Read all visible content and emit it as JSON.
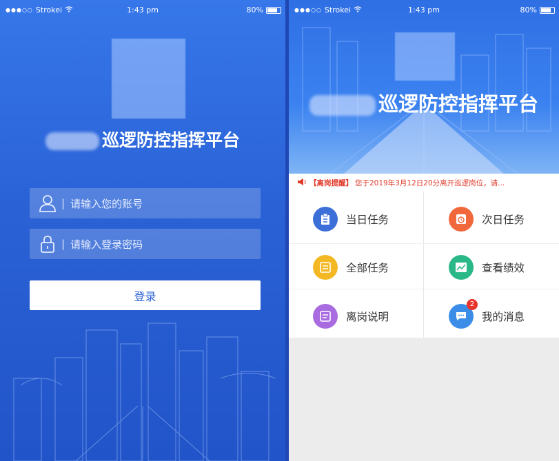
{
  "login": {
    "status": {
      "carrier": "Strokei",
      "time": "1:43 pm",
      "battery": "80%"
    },
    "title": "巡逻防控指挥平台",
    "account_placeholder": "请输入您的账号",
    "password_placeholder": "请输入登录密码",
    "login_button": "登录"
  },
  "home": {
    "status": {
      "carrier": "Strokei",
      "time": "1:43 pm",
      "battery": "80%"
    },
    "title": "巡逻防控指挥平台",
    "notice": {
      "tag": "【离岗提醒】",
      "message": "您于2019年3月12日20分离开巡逻岗位，请..."
    },
    "menu": [
      {
        "label": "当日任务",
        "icon": "clipboard-icon",
        "color": "#3d6fd8"
      },
      {
        "label": "次日任务",
        "icon": "clock-icon",
        "color": "#f0683c"
      },
      {
        "label": "全部任务",
        "icon": "list-icon",
        "color": "#f3b824"
      },
      {
        "label": "查看绩效",
        "icon": "chart-icon",
        "color": "#2bb889"
      },
      {
        "label": "离岗说明",
        "icon": "note-icon",
        "color": "#a86be0"
      },
      {
        "label": "我的消息",
        "icon": "message-icon",
        "color": "#3b8de8",
        "badge": "2"
      }
    ]
  }
}
